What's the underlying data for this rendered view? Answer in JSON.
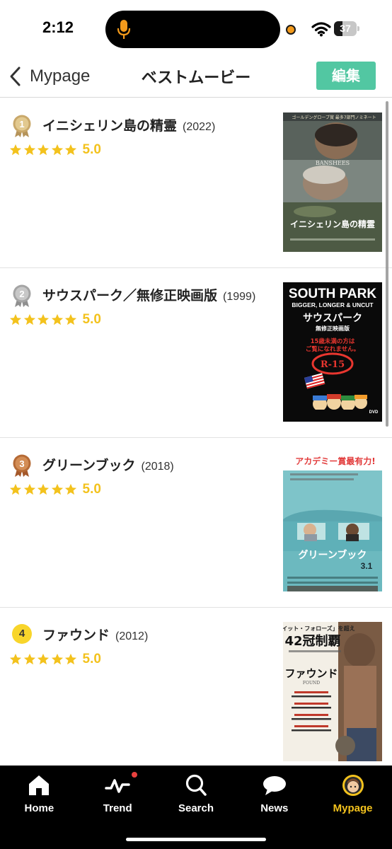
{
  "status_bar": {
    "time": "2:12",
    "battery_level": 37,
    "battery_text": "37",
    "icons": [
      "microphone-icon",
      "recording-dot-icon",
      "wifi-icon",
      "battery-icon"
    ]
  },
  "nav": {
    "back_label": "Mypage",
    "title": "ベストムービー",
    "edit_label": "編集",
    "accent_color": "#52c7a2"
  },
  "movies": [
    {
      "rank": "1",
      "badge": "gold-medal-icon",
      "title": "イニシェリン島の精霊",
      "year": "(2022)",
      "stars": 5,
      "score": "5.0",
      "poster": {
        "top_caption": "ゴールデングローブ賞 最多7部門ノミネート",
        "mid_text": "BANSHEES",
        "bottom_title": "イニシェリン島の精霊"
      }
    },
    {
      "rank": "2",
      "badge": "silver-medal-icon",
      "title": "サウスパーク／無修正映画版",
      "year": "(1999)",
      "stars": 5,
      "score": "5.0",
      "poster": {
        "title_en": "SOUTH PARK",
        "subtitle_en": "BIGGER, LONGER & UNCUT",
        "title_jp": "サウスパーク",
        "subtitle_jp": "無修正映画版",
        "warning_1": "15歳未満の方は",
        "warning_2": "ご覧になれません。",
        "rating_mark": "R-15",
        "format": "DVD"
      }
    },
    {
      "rank": "3",
      "badge": "bronze-medal-icon",
      "title": "グリーンブック",
      "year": "(2018)",
      "stars": 5,
      "score": "5.0",
      "poster": {
        "headline": "アカデミー賞最有力!",
        "bottom_title": "グリーンブック",
        "date": "3.1"
      }
    },
    {
      "rank": "4",
      "badge": "yellow-circle-badge",
      "title": "ファウンド",
      "year": "(2012)",
      "stars": 5,
      "score": "5.0",
      "poster": {
        "quote": "「イット・フォローズ」を超え",
        "awards": "42冠制覇",
        "title": "ファウンド",
        "title_en": "FOUND"
      }
    }
  ],
  "tabs": [
    {
      "label": "Home",
      "icon": "home-icon",
      "active": false
    },
    {
      "label": "Trend",
      "icon": "trend-icon",
      "active": false,
      "has_notification": true
    },
    {
      "label": "Search",
      "icon": "search-icon",
      "active": false
    },
    {
      "label": "News",
      "icon": "news-chat-icon",
      "active": false
    },
    {
      "label": "Mypage",
      "icon": "mypage-avatar-icon",
      "active": true
    }
  ],
  "colors": {
    "star": "#f3c21d",
    "active_tab": "#f3c21d",
    "notification_dot": "#e8413e"
  }
}
